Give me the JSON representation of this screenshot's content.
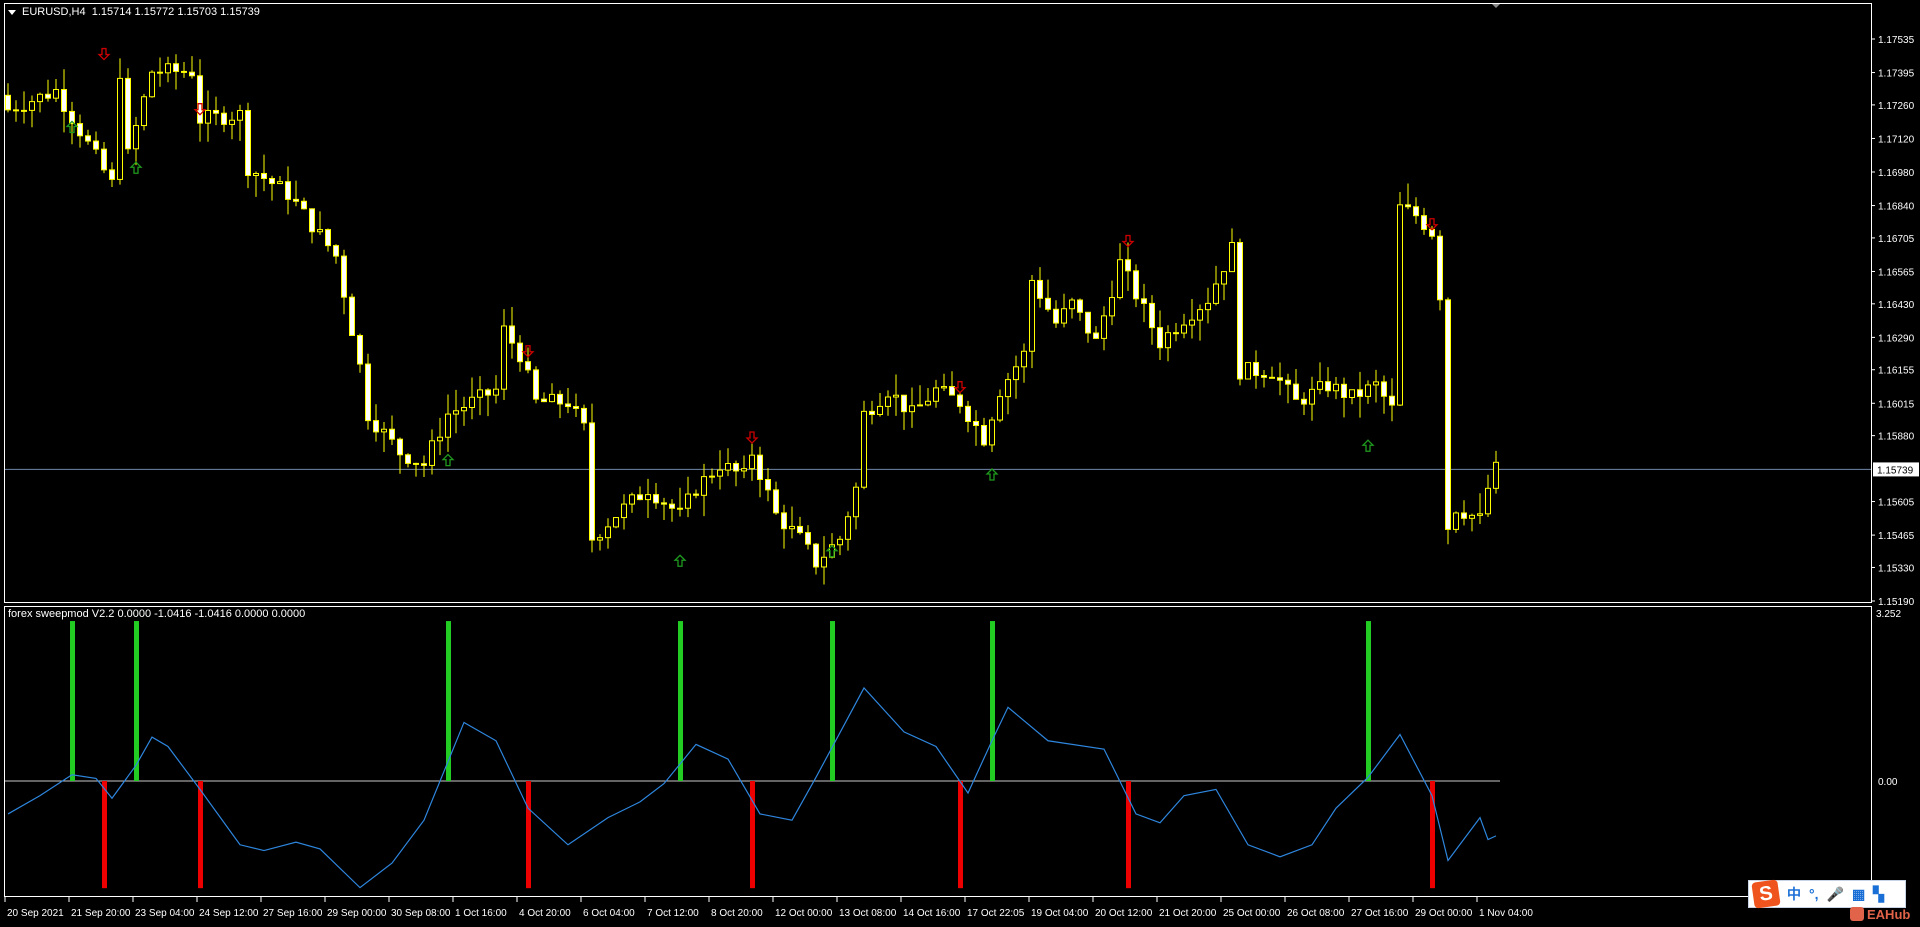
{
  "header": {
    "symbol": "EURUSD,H4",
    "ohlc": "1.15714 1.15772 1.15703 1.15739"
  },
  "indicator": {
    "title": "forex sweepmod V2.2 0.0000 -1.0416 -1.0416 0.0000 0.0000",
    "max_label": "3.252",
    "zero_label": "0.00"
  },
  "overlay": {
    "ime_logo": "S",
    "ime_items": [
      "中",
      "°,",
      "🎤",
      "▦",
      "▚"
    ],
    "watermark": "EAHub"
  },
  "colors": {
    "bull_fill": "#000000",
    "bear_fill": "#ffffff",
    "wick": "#ffff00",
    "up_arrow": "#1f9a1f",
    "down_arrow": "#cc0000",
    "hist_up": "#22cc22",
    "hist_down": "#ee0000",
    "line": "#2e86de",
    "price_line": "#7088a8"
  },
  "chart_data": [
    {
      "type": "candlestick",
      "title": "EURUSD,H4",
      "ylim": [
        1.1519,
        1.17535
      ],
      "price_ticks": [
        "1.17535",
        "1.17395",
        "1.17260",
        "1.17120",
        "1.16980",
        "1.16840",
        "1.16705",
        "1.16565",
        "1.16430",
        "1.16290",
        "1.16155",
        "1.16015",
        "1.15880",
        "1.15605",
        "1.15465",
        "1.15330",
        "1.15190"
      ],
      "current_price": "1.15739",
      "candle_count": 187,
      "close_path": [
        [
          0,
          1.1724
        ],
        [
          6,
          1.1732
        ],
        [
          13,
          1.1693
        ],
        [
          14,
          1.174
        ],
        [
          15,
          1.1705
        ],
        [
          18,
          1.174
        ],
        [
          23,
          1.174
        ],
        [
          24,
          1.172
        ],
        [
          29,
          1.1722
        ],
        [
          30,
          1.17
        ],
        [
          35,
          1.1689
        ],
        [
          41,
          1.1663
        ],
        [
          44,
          1.1617
        ],
        [
          45,
          1.1597
        ],
        [
          49,
          1.1581
        ],
        [
          52,
          1.1576
        ],
        [
          55,
          1.1597
        ],
        [
          61,
          1.1607
        ],
        [
          62,
          1.1632
        ],
        [
          64,
          1.1622
        ],
        [
          66,
          1.1602
        ],
        [
          70,
          1.1602
        ],
        [
          72,
          1.1591
        ],
        [
          73,
          1.1545
        ],
        [
          76,
          1.1555
        ],
        [
          80,
          1.1566
        ],
        [
          84,
          1.1555
        ],
        [
          86,
          1.1566
        ],
        [
          89,
          1.1576
        ],
        [
          92,
          1.1571
        ],
        [
          93,
          1.1581
        ],
        [
          96,
          1.1555
        ],
        [
          99,
          1.1545
        ],
        [
          101,
          1.1535
        ],
        [
          104,
          1.1545
        ],
        [
          106,
          1.1566
        ],
        [
          107,
          1.1597
        ],
        [
          110,
          1.1607
        ],
        [
          113,
          1.1597
        ],
        [
          116,
          1.1607
        ],
        [
          119,
          1.1602
        ],
        [
          122,
          1.1587
        ],
        [
          124,
          1.1607
        ],
        [
          127,
          1.1622
        ],
        [
          128,
          1.1653
        ],
        [
          131,
          1.1635
        ],
        [
          133,
          1.1643
        ],
        [
          136,
          1.1627
        ],
        [
          139,
          1.166
        ],
        [
          141,
          1.1647
        ],
        [
          144,
          1.1627
        ],
        [
          147,
          1.1637
        ],
        [
          150,
          1.1645
        ],
        [
          153,
          1.1666
        ],
        [
          154,
          1.1615
        ],
        [
          158,
          1.1615
        ],
        [
          161,
          1.1602
        ],
        [
          165,
          1.1609
        ],
        [
          168,
          1.1604
        ],
        [
          171,
          1.1609
        ],
        [
          173,
          1.1599
        ],
        [
          174,
          1.1683
        ],
        [
          176,
          1.168
        ],
        [
          178,
          1.1673
        ],
        [
          179,
          1.1647
        ],
        [
          180,
          1.155
        ],
        [
          181,
          1.1558
        ],
        [
          184,
          1.1553
        ],
        [
          185,
          1.1566
        ],
        [
          186,
          1.1574
        ]
      ],
      "signals_up": [
        [
          8,
          1.1717
        ],
        [
          16,
          1.17
        ],
        [
          55,
          1.1578
        ],
        [
          84,
          1.1536
        ],
        [
          103,
          1.154
        ],
        [
          123,
          1.1572
        ],
        [
          170,
          1.1584
        ]
      ],
      "signals_down": [
        [
          12,
          1.1747
        ],
        [
          24,
          1.1724
        ],
        [
          65,
          1.1623
        ],
        [
          93,
          1.1587
        ],
        [
          119,
          1.1608
        ],
        [
          140,
          1.1669
        ],
        [
          178,
          1.1676
        ]
      ],
      "time_labels": [
        "20 Sep 2021",
        "21 Sep 20:00",
        "23 Sep 04:00",
        "24 Sep 12:00",
        "27 Sep 16:00",
        "29 Sep 00:00",
        "30 Sep 08:00",
        "1 Oct 16:00",
        "4 Oct 20:00",
        "6 Oct 04:00",
        "7 Oct 12:00",
        "8 Oct 20:00",
        "12 Oct 00:00",
        "13 Oct 08:00",
        "14 Oct 16:00",
        "17 Oct 22:05",
        "19 Oct 04:00",
        "20 Oct 12:00",
        "21 Oct 20:00",
        "25 Oct 00:00",
        "26 Oct 08:00",
        "27 Oct 16:00",
        "29 Oct 00:00",
        "1 Nov 04:00"
      ]
    },
    {
      "type": "histogram+line",
      "title": "forex sweepmod V2.2",
      "ylim": [
        -2.1,
        3.252
      ],
      "hist_up": [
        [
          8,
          3.06
        ],
        [
          16,
          3.06
        ],
        [
          55,
          3.06
        ],
        [
          84,
          3.06
        ],
        [
          103,
          3.06
        ],
        [
          123,
          3.06
        ],
        [
          170,
          3.06
        ]
      ],
      "hist_down": [
        [
          12,
          -2.05
        ],
        [
          24,
          -2.05
        ],
        [
          65,
          -2.05
        ],
        [
          93,
          -2.05
        ],
        [
          119,
          -2.05
        ],
        [
          140,
          -2.05
        ],
        [
          178,
          -2.05
        ]
      ],
      "line": [
        [
          0,
          -0.63
        ],
        [
          4,
          -0.28
        ],
        [
          8,
          0.12
        ],
        [
          11,
          0.05
        ],
        [
          13,
          -0.33
        ],
        [
          16,
          0.3
        ],
        [
          18,
          0.84
        ],
        [
          20,
          0.66
        ],
        [
          24,
          -0.16
        ],
        [
          29,
          -1.22
        ],
        [
          32,
          -1.33
        ],
        [
          36,
          -1.17
        ],
        [
          39,
          -1.3
        ],
        [
          44,
          -2.04
        ],
        [
          48,
          -1.57
        ],
        [
          52,
          -0.75
        ],
        [
          57,
          1.12
        ],
        [
          61,
          0.77
        ],
        [
          65,
          -0.52
        ],
        [
          70,
          -1.22
        ],
        [
          75,
          -0.7
        ],
        [
          79,
          -0.4
        ],
        [
          82,
          -0.05
        ],
        [
          86,
          0.7
        ],
        [
          90,
          0.42
        ],
        [
          94,
          -0.63
        ],
        [
          98,
          -0.75
        ],
        [
          101,
          0.07
        ],
        [
          107,
          1.78
        ],
        [
          112,
          0.94
        ],
        [
          116,
          0.66
        ],
        [
          120,
          -0.23
        ],
        [
          123,
          0.77
        ],
        [
          125,
          1.41
        ],
        [
          130,
          0.77
        ],
        [
          137,
          0.61
        ],
        [
          141,
          -0.63
        ],
        [
          144,
          -0.8
        ],
        [
          147,
          -0.28
        ],
        [
          151,
          -0.16
        ],
        [
          155,
          -1.22
        ],
        [
          159,
          -1.45
        ],
        [
          163,
          -1.22
        ],
        [
          166,
          -0.52
        ],
        [
          170,
          0.07
        ],
        [
          174,
          0.89
        ],
        [
          178,
          -0.28
        ],
        [
          180,
          -1.52
        ],
        [
          184,
          -0.7
        ],
        [
          185,
          -1.12
        ],
        [
          186,
          -1.05
        ]
      ]
    }
  ]
}
